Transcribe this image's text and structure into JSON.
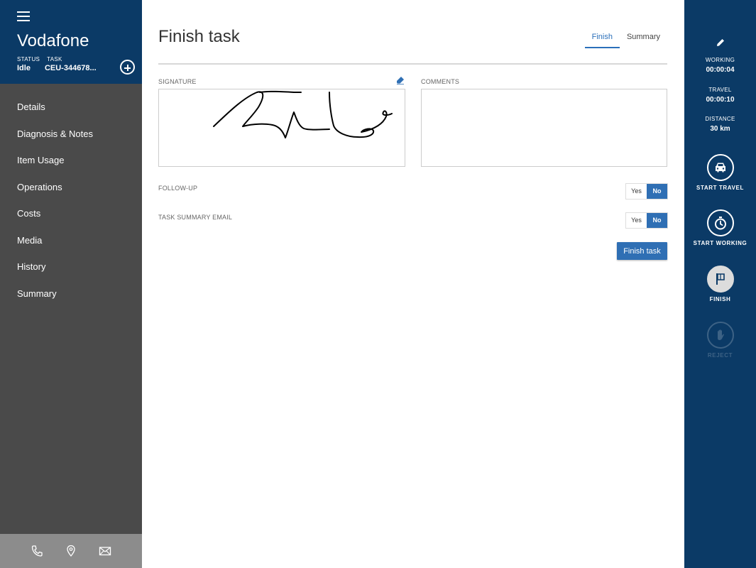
{
  "sidebar": {
    "company": "Vodafone",
    "status_label": "STATUS",
    "task_label": "TASK",
    "status_value": "Idle",
    "task_value": "CEU-344678...",
    "nav_items": [
      {
        "label": "Details"
      },
      {
        "label": "Diagnosis & Notes"
      },
      {
        "label": "Item Usage"
      },
      {
        "label": "Operations"
      },
      {
        "label": "Costs"
      },
      {
        "label": "Media"
      },
      {
        "label": "History"
      },
      {
        "label": "Summary"
      }
    ],
    "footer_icons": [
      "phone-icon",
      "location-pin-icon",
      "mail-icon"
    ]
  },
  "main": {
    "title": "Finish task",
    "tabs": [
      {
        "label": "Finish",
        "active": true
      },
      {
        "label": "Summary",
        "active": false
      }
    ],
    "signature_label": "SIGNATURE",
    "comments_label": "COMMENTS",
    "comments_value": "",
    "followup_label": "FOLLOW-UP",
    "email_label": "TASK SUMMARY EMAIL",
    "yes_label": "Yes",
    "no_label": "No",
    "followup_selected": "No",
    "email_selected": "No",
    "finish_button": "Finish task"
  },
  "right_panel": {
    "working_label": "WORKING",
    "working_value": "00:00:04",
    "travel_label": "TRAVEL",
    "travel_value": "00:00:10",
    "distance_label": "DISTANCE",
    "distance_value": "30 km",
    "start_travel_label": "START TRAVEL",
    "start_working_label": "START WORKING",
    "finish_label": "FINISH",
    "reject_label": "REJECT"
  },
  "colors": {
    "header_blue": "#0b3a66",
    "sidebar_gray": "#4a4a4a",
    "accent_blue": "#2f6fb4",
    "footer_gray": "#8c8c8c"
  }
}
